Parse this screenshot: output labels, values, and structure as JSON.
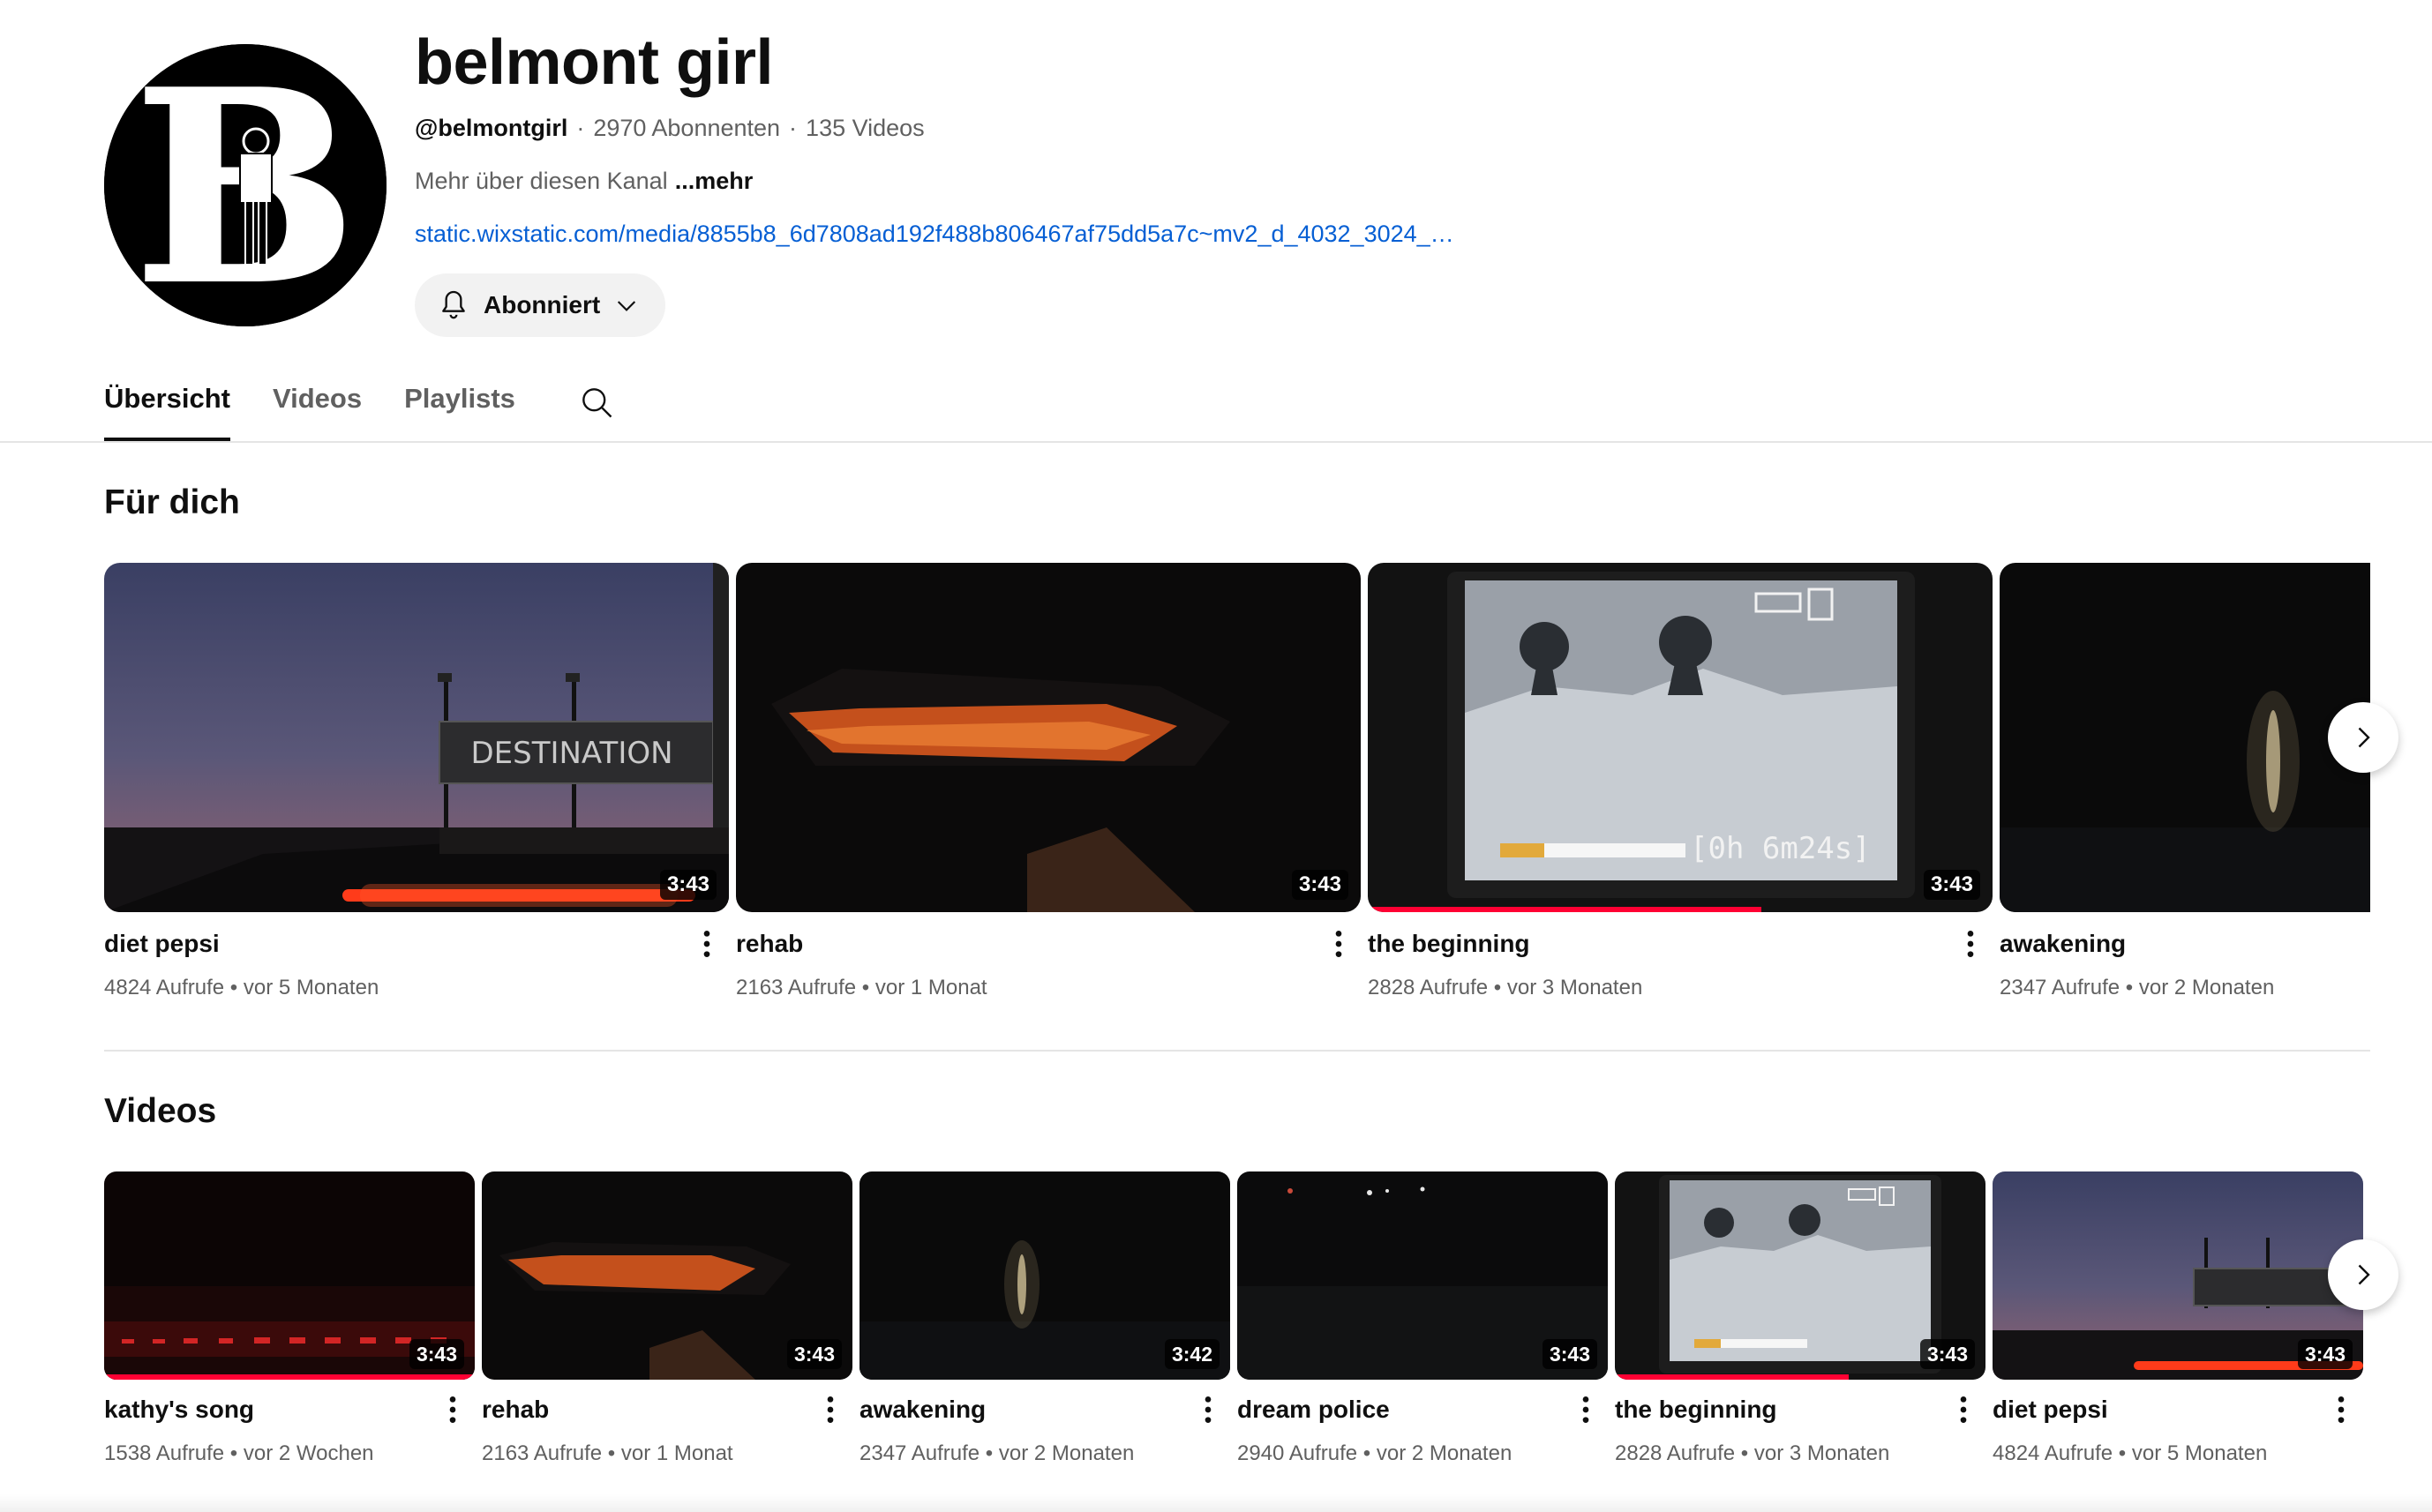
{
  "channel": {
    "name": "belmont girl",
    "handle": "@belmontgirl",
    "subscribers": "2970 Abonnenten",
    "video_count": "135 Videos",
    "about": "Mehr über diesen Kanal",
    "more": "...mehr",
    "link": "static.wixstatic.com/media/8855b8_6d7808ad192f488b806467af75dd5a7c~mv2_d_4032_3024_s_4_2.jpg",
    "subscribe_label": "Abonniert",
    "meta_separator": "·",
    "avatar_letter": "B"
  },
  "tabs": [
    {
      "label": "Übersicht",
      "active": true
    },
    {
      "label": "Videos",
      "active": false
    },
    {
      "label": "Playlists",
      "active": false
    }
  ],
  "sections": {
    "for_you": {
      "title": "Für dich",
      "videos": [
        {
          "title": "diet pepsi",
          "views": "4824 Aufrufe",
          "age": "vor 5 Monaten",
          "duration": "3:43",
          "watched": 0
        },
        {
          "title": "rehab",
          "views": "2163 Aufrufe",
          "age": "vor 1 Monat",
          "duration": "3:43",
          "watched": 0
        },
        {
          "title": "the beginning",
          "views": "2828 Aufrufe",
          "age": "vor 3 Monaten",
          "duration": "3:43",
          "watched": 0.63
        },
        {
          "title": "awakening",
          "views": "2347 Aufrufe",
          "age": "vor 2 Monaten",
          "duration": "",
          "watched": 0
        }
      ]
    },
    "videos": {
      "title": "Videos",
      "videos": [
        {
          "title": "kathy's song",
          "views": "1538 Aufrufe",
          "age": "vor 2 Wochen",
          "duration": "3:43",
          "watched": 1.0
        },
        {
          "title": "rehab",
          "views": "2163 Aufrufe",
          "age": "vor 1 Monat",
          "duration": "3:43",
          "watched": 0
        },
        {
          "title": "awakening",
          "views": "2347 Aufrufe",
          "age": "vor 2 Monaten",
          "duration": "3:42",
          "watched": 0
        },
        {
          "title": "dream police",
          "views": "2940 Aufrufe",
          "age": "vor 2 Monaten",
          "duration": "3:43",
          "watched": 0
        },
        {
          "title": "the beginning",
          "views": "2828 Aufrufe",
          "age": "vor 3 Monaten",
          "duration": "3:43",
          "watched": 0.63
        },
        {
          "title": "diet pepsi",
          "views": "4824 Aufrufe",
          "age": "vor 5 Monaten",
          "duration": "3:43",
          "watched": 0
        }
      ]
    }
  },
  "thumb_text": {
    "destination_sign": "DESTINATION",
    "camera_timer": "[0h 6m24s]"
  },
  "colors": {
    "accent_link": "#065fd4",
    "progress_red": "#ff0033",
    "text_primary": "#0f0f0f",
    "text_secondary": "#606060"
  },
  "icons": {
    "subscribe": "bell-icon",
    "subscribe_menu": "chevron-down-icon",
    "tab_search": "search-icon",
    "card_menu": "more-vert-icon",
    "shelf_next": "chevron-right-icon"
  }
}
